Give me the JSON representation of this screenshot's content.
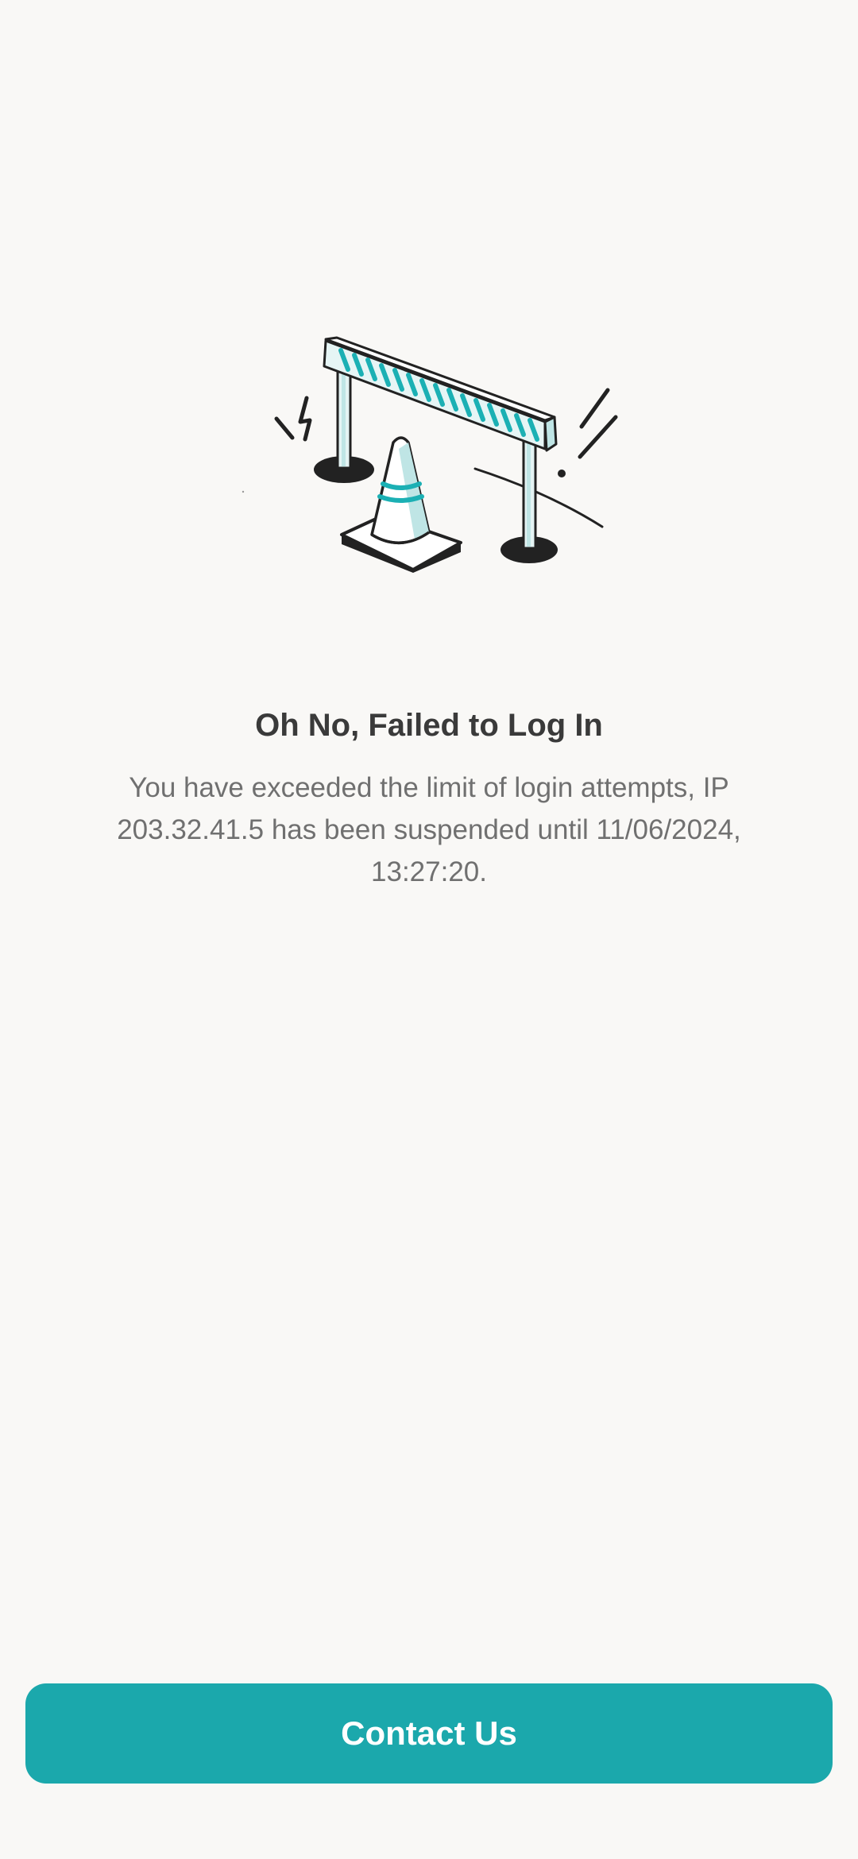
{
  "illustration": {
    "name": "roadblock-barrier-illustration",
    "colors": {
      "accent": "#1bb0b4",
      "light_accent": "#bfe5e5",
      "ink": "#222222"
    }
  },
  "error": {
    "title": "Oh No, Failed to Log In",
    "message": "You have exceeded the limit of login attempts, IP 203.32.41.5 has been suspended until 11/06/2024, 13:27:20."
  },
  "actions": {
    "contact_label": "Contact Us"
  },
  "colors": {
    "background": "#f9f8f6",
    "primary": "#1ba8ac",
    "title_text": "#3a3a3a",
    "body_text": "#707070"
  }
}
